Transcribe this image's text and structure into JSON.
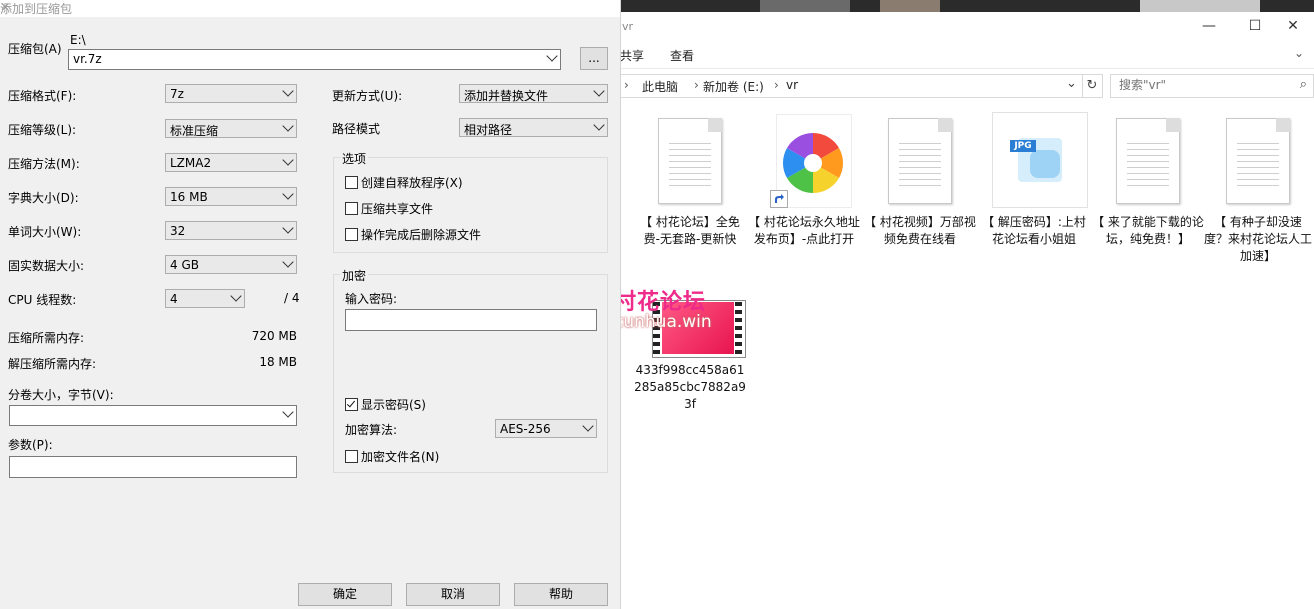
{
  "explorer": {
    "title": "vr",
    "window_buttons": {
      "minimize": "—",
      "maximize": "☐",
      "close": "✕"
    },
    "ribbon": {
      "share": "共享",
      "view": "查看",
      "expand": "⌄"
    },
    "address": {
      "segments": [
        "此电脑",
        "新加卷 (E:)",
        "vr"
      ],
      "separator": "›"
    },
    "search_placeholder": "搜索\"vr\"",
    "files": [
      {
        "name": "【 村花论坛】全免费-无套路-更新快",
        "kind": "document"
      },
      {
        "name": "【 村花论坛永久地址发布页】-点此打开",
        "kind": "shortcut"
      },
      {
        "name": "【 村花视频】万部视频免费在线看",
        "kind": "document"
      },
      {
        "name": "【 解压密码】:上村花论坛看小姐姐",
        "kind": "jpg"
      },
      {
        "name": "【 来了就能下载的论坛，纯免费！】",
        "kind": "document"
      },
      {
        "name": "【 有种子却没速度？来村花论坛人工加速】",
        "kind": "document"
      },
      {
        "name": "433f998cc458a61285a85cbc7882a93f",
        "kind": "video"
      }
    ],
    "jpg_badge": "JPG"
  },
  "watermark": {
    "line1": "村花论坛",
    "line2": "cunhua.win"
  },
  "dialog": {
    "title": "添加到压缩包",
    "close": "✕",
    "archive_label": "压缩包(A)",
    "archive_dir": "E:\\",
    "archive_name": "vr.7z",
    "browse": "...",
    "format_label": "压缩格式(F):",
    "format_value": "7z",
    "level_label": "压缩等级(L):",
    "level_value": "标准压缩",
    "method_label": "压缩方法(M):",
    "method_value": "LZMA2",
    "dict_label": "字典大小(D):",
    "dict_value": "16 MB",
    "word_label": "单词大小(W):",
    "word_value": "32",
    "solid_label": "固实数据大小:",
    "solid_value": "4 GB",
    "cpu_label": "CPU 线程数:",
    "cpu_value": "4",
    "cpu_total": "/ 4",
    "mem_comp_label": "压缩所需内存:",
    "mem_comp_value": "720 MB",
    "mem_decomp_label": "解压缩所需内存:",
    "mem_decomp_value": "18 MB",
    "volume_label": "分卷大小，字节(V):",
    "params_label": "参数(P):",
    "update_label": "更新方式(U):",
    "update_value": "添加并替换文件",
    "path_label": "路径模式",
    "path_value": "相对路径",
    "options_title": "选项",
    "opt_sfx": "创建自释放程序(X)",
    "opt_shared": "压缩共享文件",
    "opt_delete": "操作完成后删除源文件",
    "encrypt_title": "加密",
    "password_label": "输入密码:",
    "show_password": "显示密码(S)",
    "enc_method_label": "加密算法:",
    "enc_method_value": "AES-256",
    "encrypt_names": "加密文件名(N)",
    "ok": "确定",
    "cancel": "取消",
    "help": "帮助"
  }
}
